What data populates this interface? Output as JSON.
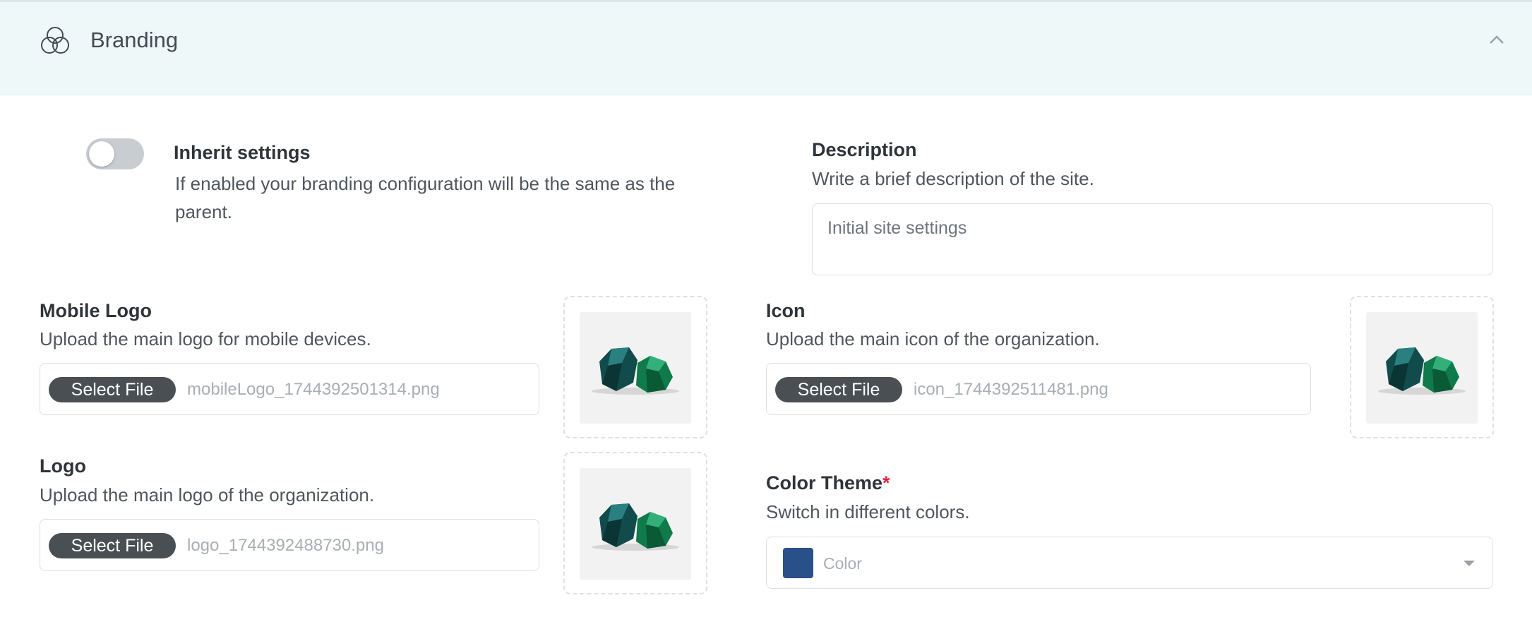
{
  "header": {
    "title": "Branding",
    "icon": "venn-circles-icon",
    "collapse_icon": "chevron-up-icon"
  },
  "inherit": {
    "enabled": false,
    "label": "Inherit settings",
    "help": "If enabled your branding configuration will be the same as the parent."
  },
  "description": {
    "label": "Description",
    "help": "Write a brief description of the site.",
    "value": "Initial site settings"
  },
  "mobile_logo": {
    "label": "Mobile Logo",
    "help": "Upload the main logo for mobile devices.",
    "button_label": "Select File",
    "file_name": "mobileLogo_1744392501314.png"
  },
  "logo": {
    "label": "Logo",
    "help": "Upload the main logo of the organization.",
    "button_label": "Select File",
    "file_name": "logo_1744392488730.png"
  },
  "icon": {
    "label": "Icon",
    "help": "Upload the main icon of the organization.",
    "button_label": "Select File",
    "file_name": "icon_1744392511481.png"
  },
  "color_theme": {
    "label": "Color Theme",
    "required_mark": "*",
    "help": "Switch in different colors.",
    "placeholder": "Color",
    "selected_color": "#2a5089"
  },
  "colors": {
    "header_bg": "#eef8f8",
    "button_bg": "#4a4f53",
    "required": "#e0223a"
  }
}
